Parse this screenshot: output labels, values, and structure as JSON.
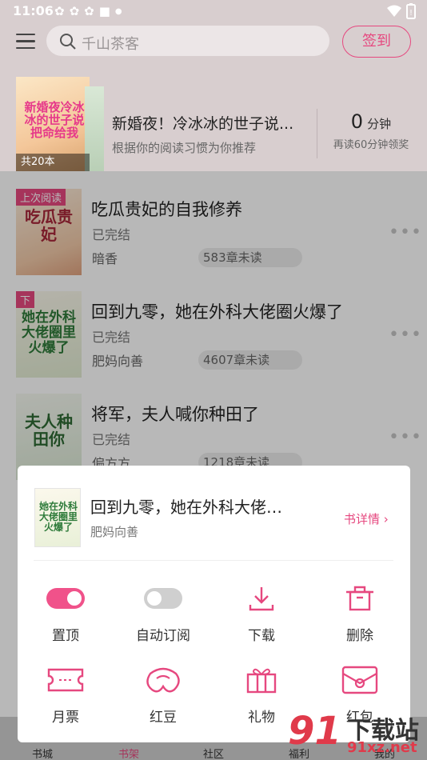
{
  "status_bar": {
    "time": "11:06",
    "battery": "battery"
  },
  "header": {
    "search_placeholder": "千山茶客",
    "signin_label": "签到"
  },
  "recommend": {
    "cover_title": "新婚夜冷冰冰的世子说把命给我",
    "count_badge": "共20本",
    "title": "新婚夜！冷冰冰的世子说...",
    "subtitle": "根据你的阅读习惯为你推荐",
    "minutes_value": "0",
    "minutes_unit": "分钟",
    "minutes_tip": "再读60分钟领奖"
  },
  "books": [
    {
      "tag": "上次阅读",
      "cover_text": "吃瓜贵妃",
      "title": "吃瓜贵妃的自我修养",
      "status": "已完结",
      "author": "暗香",
      "unread": "583章未读",
      "more": "•••"
    },
    {
      "tag": "下",
      "cover_text": "她在外科大佬圈里火爆了",
      "title": "回到九零，她在外科大佬圈火爆了",
      "status": "已完结",
      "author": "肥妈向善",
      "unread": "4607章未读",
      "more": "•••"
    },
    {
      "tag": "",
      "cover_text": "夫人种田你",
      "title": "将军，夫人喊你种田了",
      "status": "已完结",
      "author": "偏方方",
      "unread": "1218章未读",
      "more": "•••"
    }
  ],
  "bottom_nav": [
    "书城",
    "书架",
    "社区",
    "福利",
    "我的"
  ],
  "sheet": {
    "cover_text": "她在外科大佬圈里火爆了",
    "title": "回到九零，她在外科大佬…",
    "author": "肥妈向善",
    "detail_label": "书详情 ›",
    "actions": [
      {
        "label": "置顶",
        "icon": "toggle-on-icon"
      },
      {
        "label": "自动订阅",
        "icon": "toggle-off-icon"
      },
      {
        "label": "下载",
        "icon": "download-icon"
      },
      {
        "label": "删除",
        "icon": "trash-icon"
      },
      {
        "label": "月票",
        "icon": "ticket-icon"
      },
      {
        "label": "红豆",
        "icon": "red-bean-icon"
      },
      {
        "label": "礼物",
        "icon": "gift-icon"
      },
      {
        "label": "红包",
        "icon": "red-packet-icon"
      }
    ],
    "toggles": {
      "pin_on": true,
      "auto_subscribe_on": false
    }
  },
  "watermark": {
    "big": "91",
    "text1": "下载站",
    "text2": "91xz.net"
  },
  "colors": {
    "accent": "#e6487f",
    "header_bg": "#d8cecf"
  }
}
